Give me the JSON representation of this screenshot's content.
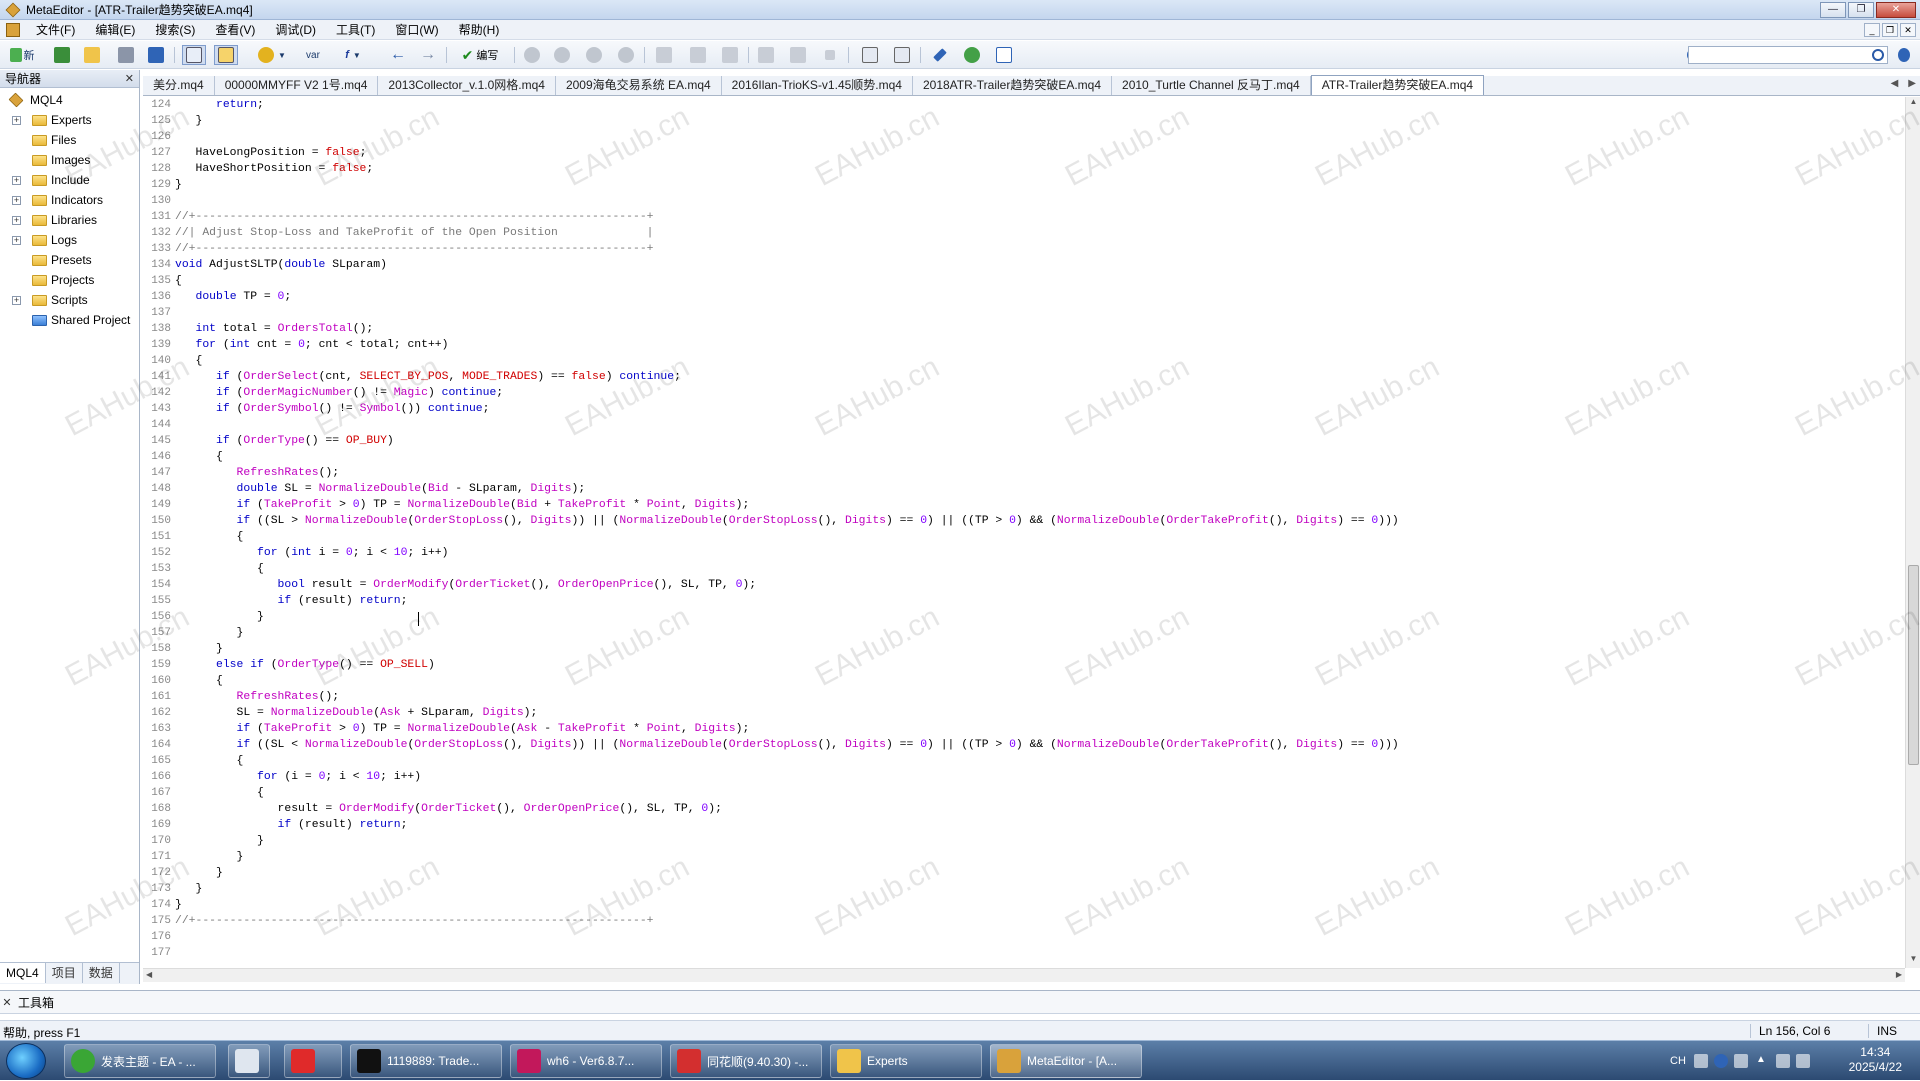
{
  "window": {
    "title": "MetaEditor - [ATR-Trailer趋势突破EA.mq4]"
  },
  "menu": [
    "文件(F)",
    "编辑(E)",
    "搜索(S)",
    "查看(V)",
    "调试(D)",
    "工具(T)",
    "窗口(W)",
    "帮助(H)"
  ],
  "toolbar": {
    "new_label": "新",
    "compile_label": "编写",
    "var_label": "var",
    "search_placeholder": ""
  },
  "navigator": {
    "title": "导航器",
    "root": "MQL4",
    "items": [
      "Experts",
      "Files",
      "Images",
      "Include",
      "Indicators",
      "Libraries",
      "Logs",
      "Presets",
      "Projects",
      "Scripts",
      "Shared Project"
    ],
    "expandable": [
      true,
      false,
      false,
      true,
      true,
      true,
      true,
      false,
      false,
      true,
      false
    ],
    "tabs": [
      "MQL4",
      "项目",
      "数据"
    ]
  },
  "tabs": [
    "美分.mq4",
    "00000MMYFF V2  1号.mq4",
    "2013Collector_v.1.0网格.mq4",
    "2009海龟交易系统 EA.mq4",
    "2016Ilan-TrioKS-v1.45顺势.mq4",
    "2018ATR-Trailer趋势突破EA.mq4",
    "2010_Turtle Channel 反马丁.mq4",
    "ATR-Trailer趋势突破EA.mq4"
  ],
  "active_tab": 7,
  "editor": {
    "first_line": 124,
    "lines": [
      "      return;",
      "   }",
      "",
      "   HaveLongPosition = false;",
      "   HaveShortPosition = false;",
      "}",
      "",
      "//+------------------------------------------------------------------+",
      "//| Adjust Stop-Loss and TakeProfit of the Open Position             |",
      "//+------------------------------------------------------------------+",
      "void AdjustSLTP(double SLparam)",
      "{",
      "   double TP = 0;",
      "",
      "   int total = OrdersTotal();",
      "   for (int cnt = 0; cnt < total; cnt++)",
      "   {",
      "      if (OrderSelect(cnt, SELECT_BY_POS, MODE_TRADES) == false) continue;",
      "      if (OrderMagicNumber() != Magic) continue;",
      "      if (OrderSymbol() != Symbol()) continue;",
      "",
      "      if (OrderType() == OP_BUY)",
      "      {",
      "         RefreshRates();",
      "         double SL = NormalizeDouble(Bid - SLparam, Digits);",
      "         if (TakeProfit > 0) TP = NormalizeDouble(Bid + TakeProfit * Point, Digits);",
      "         if ((SL > NormalizeDouble(OrderStopLoss(), Digits)) || (NormalizeDouble(OrderStopLoss(), Digits) == 0) || ((TP > 0) && (NormalizeDouble(OrderTakeProfit(), Digits) == 0)))",
      "         {",
      "            for (int i = 0; i < 10; i++)",
      "            {",
      "               bool result = OrderModify(OrderTicket(), OrderOpenPrice(), SL, TP, 0);",
      "               if (result) return;",
      "            }",
      "         }",
      "      }",
      "      else if (OrderType() == OP_SELL)",
      "      {",
      "         RefreshRates();",
      "         SL = NormalizeDouble(Ask + SLparam, Digits);",
      "         if (TakeProfit > 0) TP = NormalizeDouble(Ask - TakeProfit * Point, Digits);",
      "         if ((SL < NormalizeDouble(OrderStopLoss(), Digits)) || (NormalizeDouble(OrderStopLoss(), Digits) == 0) || ((TP > 0) && (NormalizeDouble(OrderTakeProfit(), Digits) == 0)))",
      "         {",
      "            for (i = 0; i < 10; i++)",
      "            {",
      "               result = OrderModify(OrderTicket(), OrderOpenPrice(), SL, TP, 0);",
      "               if (result) return;",
      "            }",
      "         }",
      "      }",
      "   }",
      "}",
      "//+------------------------------------------------------------------+",
      "",
      ""
    ],
    "cursor_line": 156
  },
  "watermark": "EAHub.cn",
  "toolbox": {
    "label": "工具箱"
  },
  "status": {
    "help": "帮助, press F1",
    "position": "Ln 156, Col 6",
    "mode": "INS"
  },
  "taskbar": {
    "items": [
      "发表主题 - EA - ...",
      "",
      "",
      "1119889: Trade...",
      "wh6 - Ver6.8.7...",
      "同花顺(9.40.30) -...",
      "Experts",
      "MetaEditor - [A..."
    ],
    "tray_lang": "CH",
    "time": "14:34",
    "date": "2025/4/22"
  }
}
